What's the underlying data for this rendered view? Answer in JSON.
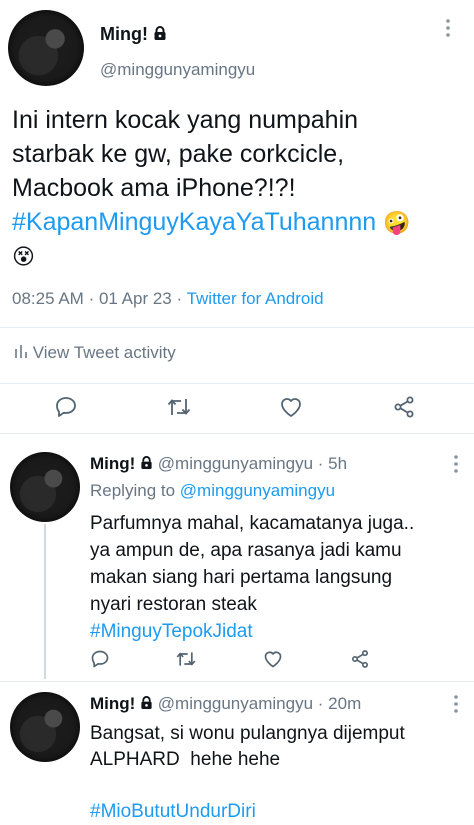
{
  "main_tweet": {
    "display_name": "Ming!",
    "handle": "@minggunyamingyu",
    "text_line1": "Ini intern kocak yang numpahin",
    "text_line2": "starbak ke gw, pake corkcicle,",
    "text_line3": "Macbook ama iPhone?!?!",
    "hashtag": "#KapanMinguyKayaYaTuhannnn",
    "emoji1": "🤪",
    "emoji2": "😵",
    "time": "08:25 AM",
    "sep1": "·",
    "date": "01 Apr 23",
    "sep2": "·",
    "source": "Twitter for Android",
    "activity_label": "View Tweet activity"
  },
  "reply1": {
    "display_name": "Ming!",
    "handle": "@minggunyamingyu",
    "sep": "·",
    "age": "5h",
    "replying_prefix": "Replying to",
    "replying_handle": "@minggunyamingyu",
    "line1": "Parfumnya mahal, kacamatanya juga..",
    "line2": "ya ampun de, apa rasanya jadi kamu",
    "line3": "makan siang hari pertama langsung",
    "line4": "nyari restoran steak",
    "hashtag": "#MinguyTepokJidat"
  },
  "reply2": {
    "display_name": "Ming!",
    "handle": "@minggunyamingyu",
    "sep": "·",
    "age": "20m",
    "line1": "Bangsat, si wonu pulangnya dijemput",
    "line2": "ALPHARD  hehe hehe",
    "hashtag": "#MioBututUndurDiri"
  },
  "icons": [
    "lock-icon",
    "more-icon",
    "reply-icon",
    "retweet-icon",
    "like-icon",
    "share-icon",
    "activity-icon"
  ],
  "colors": {
    "link": "#1d9bf0",
    "secondary": "#687684",
    "text": "#0f1419",
    "divider": "#e6ecf0"
  }
}
